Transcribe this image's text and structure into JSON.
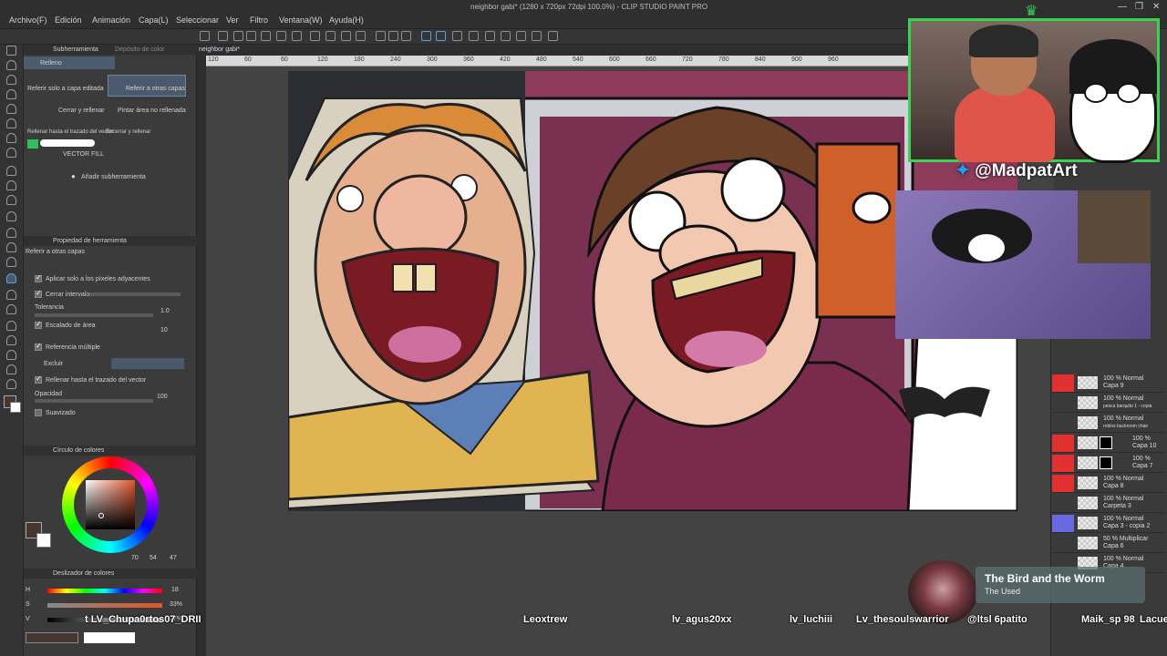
{
  "window": {
    "title": "neighbor gabi* (1280 x 720px 72dpi 100.0%) - CLIP STUDIO PAINT PRO",
    "controls": [
      "—",
      "❐",
      "✕"
    ]
  },
  "menu": {
    "items": [
      "Archivo(F)",
      "Edición",
      "Animación",
      "Capa(L)",
      "Seleccionar",
      "Ver",
      "Filtro",
      "Ventana(W)",
      "Ayuda(H)"
    ]
  },
  "canvas": {
    "tab_label": "neighbor gabi*",
    "ruler_ticks": [
      "120",
      "60",
      "60",
      "120",
      "180",
      "240",
      "300",
      "360",
      "420",
      "480",
      "540",
      "600",
      "660",
      "720",
      "780",
      "840",
      "900",
      "960"
    ]
  },
  "subtool_panel": {
    "tabs": [
      "Subherramienta",
      "Depósito de color"
    ],
    "group": "Relleno",
    "tools": [
      "Referir solo a capa editada",
      "Referir a otras capas",
      "Cerrar y rellenar",
      "Pintar área no rellenada",
      "Rellenar hasta el trazado del vector",
      "Encerrar y rellenar",
      "VECTOR FILL"
    ],
    "add_label": "Añadir subherramienta"
  },
  "tool_property": {
    "header": "Propiedad de herramienta",
    "subtitle": "Referir a otras capas",
    "options": {
      "adjacent": "Aplicar solo a los píxeles adyacentes",
      "close_gap": "Cerrar intervalo",
      "tolerance_label": "Tolerancia",
      "tolerance_value": "1.0",
      "area_scale_label": "Escalado de área",
      "area_scale_value": "10",
      "multi_ref": "Referencia múltiple",
      "exclude": "Excluir",
      "fill_vector": "Rellenar hasta el trazado del vector",
      "opacity_label": "Opacidad",
      "opacity_value": "100",
      "smooth": "Suavizado"
    }
  },
  "color_wheel": {
    "header": "Círculo de colores",
    "r": "70",
    "g": "54",
    "b": "47",
    "main_color": "#46362f",
    "sub_color": "#ffffff"
  },
  "color_slider": {
    "header": "Deslizador de colores",
    "h_label": "H",
    "h_value": "18",
    "s_label": "S",
    "s_value": "33%",
    "v_label": "V",
    "v_value": "27%"
  },
  "overlay": {
    "handle": "@MadpatArt",
    "twitter_icon": "twitter-bird-icon"
  },
  "layers": {
    "rows": [
      {
        "mode": "100 % Normal",
        "name": "Capa 9",
        "swatch": "#e03030"
      },
      {
        "mode": "100 % Normal",
        "name": "pesca barquito 1 - copia",
        "swatch": "#3a3a3a"
      },
      {
        "mode": "100 % Normal",
        "name": "roblox backroom chair",
        "swatch": "#3a3a3a"
      },
      {
        "mode": "100 %",
        "name": "Capa 10",
        "swatch": "#e03030"
      },
      {
        "mode": "100 %",
        "name": "Capa 7",
        "swatch": "#e03030"
      },
      {
        "mode": "100 % Normal",
        "name": "Capa 8",
        "swatch": "#e03030"
      },
      {
        "mode": "100 % Normal",
        "name": "Carpeta 3",
        "swatch": "#3a3a3a"
      },
      {
        "mode": "100 % Normal",
        "name": "Capa 3 - copia 2",
        "swatch": "#6a6ae0"
      },
      {
        "mode": "50 % Multiplicar",
        "name": "Capa 6",
        "swatch": "#3a3a3a"
      },
      {
        "mode": "100 % Normal",
        "name": "Capa 4",
        "swatch": "#3a3a3a"
      }
    ]
  },
  "song": {
    "title": "The Bird and the Worm",
    "artist": "The Used"
  },
  "chat": {
    "names": [
      "t LV_Chupa0rtos07_DRII",
      "Leoxtrew",
      "lv_agus20xx",
      "lv_luchiii",
      "Lv_thesoulswarrior",
      "@ltsl 6patito",
      "Maik_sp 98",
      "Lacue"
    ]
  }
}
